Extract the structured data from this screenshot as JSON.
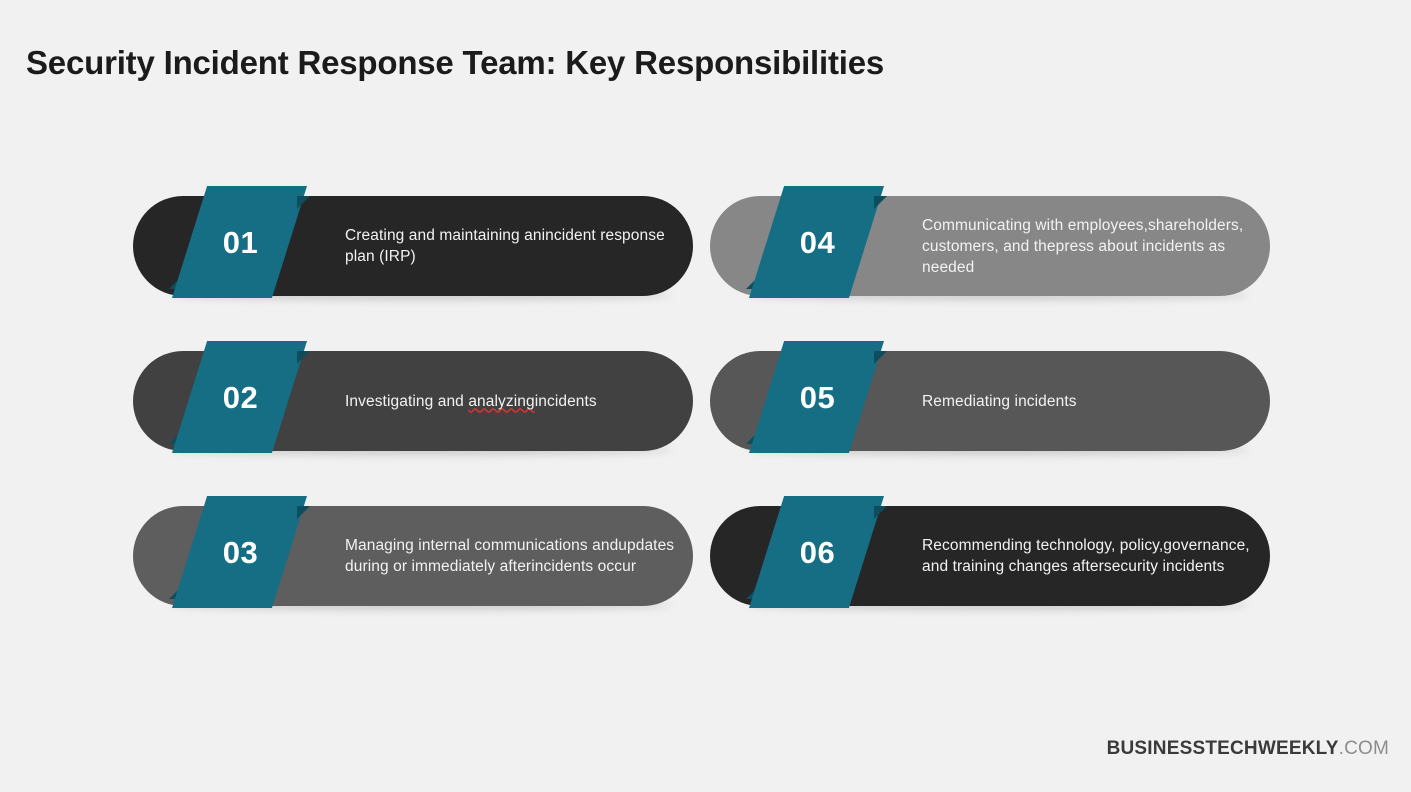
{
  "page": {
    "title": "Security Incident Response Team: Key Responsibilities",
    "background_color": "#f1f1f1",
    "accent_color": "#166e85",
    "accent_shadow_color": "#0e4d5e"
  },
  "cards": [
    {
      "number": "01",
      "text": "Creating and maintaining an incident response plan (IRP)",
      "lines": [
        "Creating and maintaining an",
        "incident response plan (IRP)"
      ],
      "pill_color": "#262626",
      "column": "left"
    },
    {
      "number": "02",
      "text": "Investigating and analyzing incidents",
      "lines": [
        "Investigating and analyzing",
        "incidents"
      ],
      "spellcheck_word": "analyzing",
      "pill_color": "#414141",
      "column": "left"
    },
    {
      "number": "03",
      "text": "Managing internal communications and updates during or immediately after incidents occur",
      "lines": [
        "Managing internal communications and",
        "updates during or immediately after",
        "incidents occur"
      ],
      "pill_color": "#5e5e5e",
      "column": "left"
    },
    {
      "number": "04",
      "text": "Communicating with employees, shareholders, customers, and the press about incidents as needed",
      "lines": [
        "Communicating with employees,",
        "shareholders, customers, and the",
        "press about incidents as needed"
      ],
      "pill_color": "#878787",
      "column": "right"
    },
    {
      "number": "05",
      "text": "Remediating incidents",
      "lines": [
        "Remediating incidents"
      ],
      "pill_color": "#575757",
      "column": "right"
    },
    {
      "number": "06",
      "text": "Recommending technology, policy, governance, and training changes after security incidents",
      "lines": [
        "Recommending technology, policy,",
        "governance, and training changes after",
        "security incidents"
      ],
      "pill_color": "#262626",
      "column": "right"
    }
  ],
  "footer": {
    "brand_main": "BUSINESSTECHWEEKLY",
    "brand_tld": ".COM"
  }
}
